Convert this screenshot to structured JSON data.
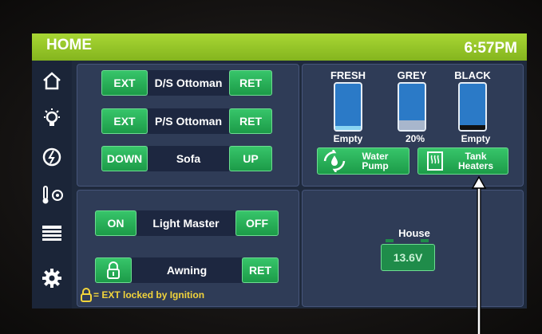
{
  "header": {
    "title": "HOME",
    "time": "6:57PM"
  },
  "sidebar": {
    "items": [
      {
        "icon": "home-icon"
      },
      {
        "icon": "light-bulb-icon"
      },
      {
        "icon": "power-icon"
      },
      {
        "icon": "temperature-fan-icon"
      },
      {
        "icon": "shade-blinds-icon"
      },
      {
        "icon": "gear-icon"
      }
    ]
  },
  "slides": {
    "row1": {
      "left": "EXT",
      "label": "D/S Ottoman",
      "right": "RET"
    },
    "row2": {
      "left": "EXT",
      "label": "P/S Ottoman",
      "right": "RET"
    },
    "row3": {
      "left": "DOWN",
      "label": "Sofa",
      "right": "UP"
    }
  },
  "lights": {
    "on": "ON",
    "label": "Light Master",
    "off": "OFF",
    "awning_label": "Awning",
    "awning_right": "RET",
    "lock_note": "= EXT locked by Ignition"
  },
  "tanks": {
    "items": [
      {
        "name": "FRESH",
        "value": "Empty",
        "fill": 0.08,
        "fill_color": "#8ad4f2"
      },
      {
        "name": "GREY",
        "value": "20%",
        "fill": 0.2,
        "fill_color": "#a8b6cc"
      },
      {
        "name": "BLACK",
        "value": "Empty",
        "fill": 0.1,
        "fill_color": "#111111"
      }
    ],
    "water_pump": "Water Pump",
    "tank_heaters": "Tank Heaters"
  },
  "battery": {
    "label": "House",
    "value": "13.6V"
  },
  "colors": {
    "accent_green": "#1c9b48",
    "topbar_green": "#9acb2a"
  }
}
